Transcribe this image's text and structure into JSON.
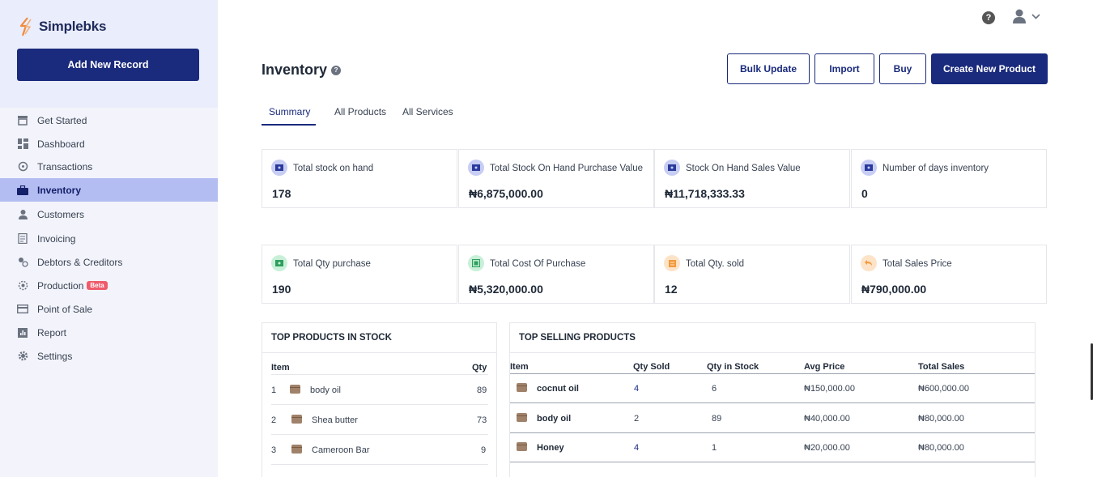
{
  "app": {
    "name": "Simplebks",
    "add_record": "Add New Record"
  },
  "colors": {
    "primary": "#1a2a7c",
    "active_nav": "#b4bdf2",
    "beta": "#ef5b6b"
  },
  "sidebar": {
    "items": [
      {
        "label": "Get Started",
        "icon": "store-icon"
      },
      {
        "label": "Dashboard",
        "icon": "dashboard-icon"
      },
      {
        "label": "Transactions",
        "icon": "transactions-icon"
      },
      {
        "label": "Inventory",
        "icon": "briefcase-icon",
        "active": true
      },
      {
        "label": "Customers",
        "icon": "user-icon"
      },
      {
        "label": "Invoicing",
        "icon": "invoice-icon"
      },
      {
        "label": "Debtors & Creditors",
        "icon": "debtors-icon"
      },
      {
        "label": "Production",
        "icon": "production-icon",
        "badge": "Beta"
      },
      {
        "label": "Point of Sale",
        "icon": "card-icon"
      },
      {
        "label": "Report",
        "icon": "report-icon"
      },
      {
        "label": "Settings",
        "icon": "gear-icon"
      }
    ]
  },
  "header": {
    "help": "?"
  },
  "page": {
    "title": "Inventory",
    "buttons": {
      "bulk_update": "Bulk Update",
      "import": "Import",
      "buy": "Buy",
      "create": "Create New Product"
    },
    "tabs": [
      "Summary",
      "All Products",
      "All Services"
    ]
  },
  "cards_row1": [
    {
      "label": "Total stock on hand",
      "value": "178"
    },
    {
      "label": "Total Stock On Hand Purchase Value",
      "value": "₦6,875,000.00"
    },
    {
      "label": "Stock On Hand Sales Value",
      "value": "₦11,718,333.33"
    },
    {
      "label": "Number of days inventory",
      "value": "0"
    }
  ],
  "cards_row2": [
    {
      "label": "Total Qty purchase",
      "value": "190"
    },
    {
      "label": "Total Cost Of Purchase",
      "value": "₦5,320,000.00"
    },
    {
      "label": "Total Qty. sold",
      "value": "12"
    },
    {
      "label": "Total Sales Price",
      "value": "₦790,000.00"
    }
  ],
  "top_stock": {
    "title": "TOP PRODUCTS IN STOCK",
    "headers": {
      "item": "Item",
      "qty": "Qty"
    },
    "rows": [
      {
        "rank": "1",
        "name": "body oil",
        "qty": "89"
      },
      {
        "rank": "2",
        "name": "Shea butter",
        "qty": "73"
      },
      {
        "rank": "3",
        "name": "Cameroon Bar",
        "qty": "9"
      }
    ]
  },
  "top_selling": {
    "title": "TOP SELLING PRODUCTS",
    "headers": {
      "item": "Item",
      "qty_sold": "Qty Sold",
      "qty_stock": "Qty in Stock",
      "avg_price": "Avg Price",
      "total_sales": "Total Sales"
    },
    "rows": [
      {
        "name": "cocnut oil",
        "qty_sold": "4",
        "qty_stock": "6",
        "avg_price": "₦150,000.00",
        "total_sales": "₦600,000.00"
      },
      {
        "name": "body oil",
        "qty_sold": "2",
        "qty_stock": "89",
        "avg_price": "₦40,000.00",
        "total_sales": "₦80,000.00"
      },
      {
        "name": "Honey",
        "qty_sold": "4",
        "qty_stock": "1",
        "avg_price": "₦20,000.00",
        "total_sales": "₦80,000.00"
      }
    ]
  }
}
